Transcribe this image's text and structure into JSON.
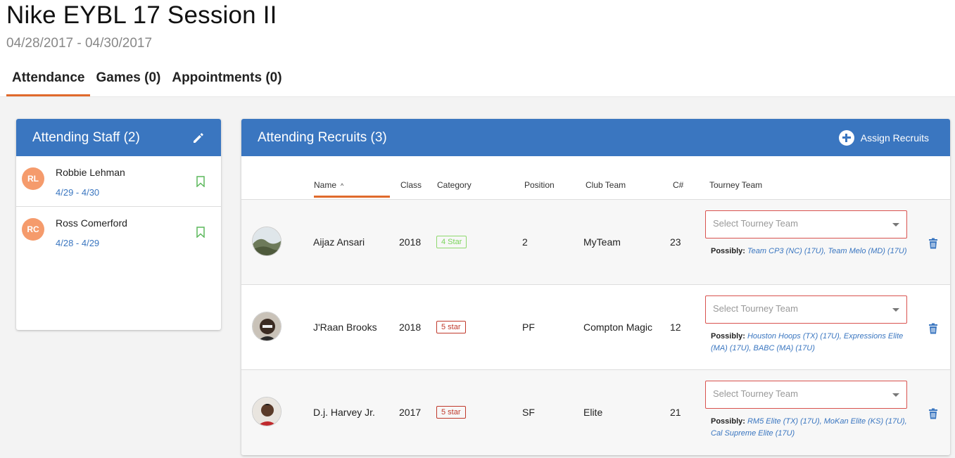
{
  "event": {
    "title": "Nike EYBL 17 Session II",
    "dates": "04/28/2017 - 04/30/2017"
  },
  "tabs": [
    {
      "label": "Attendance",
      "active": true
    },
    {
      "label": "Games (0)",
      "active": false
    },
    {
      "label": "Appointments (0)",
      "active": false
    }
  ],
  "staff": {
    "title": "Attending Staff (2)",
    "members": [
      {
        "initials": "RL",
        "name": "Robbie Lehman",
        "dates": "4/29 - 4/30"
      },
      {
        "initials": "RC",
        "name": "Ross Comerford",
        "dates": "4/28 - 4/29"
      }
    ]
  },
  "recruits": {
    "title": "Attending Recruits (3)",
    "assign_label": "Assign Recruits",
    "columns": {
      "name": "Name",
      "class": "Class",
      "category": "Category",
      "position": "Position",
      "club_team": "Club Team",
      "c_num": "C#",
      "tourney_team": "Tourney Team"
    },
    "rows": [
      {
        "name": "Aijaz Ansari",
        "class": "2018",
        "category": "4 Star",
        "category_color": "#7ad35a",
        "position": "2",
        "club_team": "MyTeam",
        "c_num": "23",
        "select_placeholder": "Select Tourney Team",
        "possibly_label": "Possibly:",
        "possibly_teams": "Team CP3 (NC) (17U), Team Melo (MD) (17U)"
      },
      {
        "name": "J'Raan Brooks",
        "class": "2018",
        "category": "5 star",
        "category_color": "#c0392b",
        "position": "PF",
        "club_team": "Compton Magic",
        "c_num": "12",
        "select_placeholder": "Select Tourney Team",
        "possibly_label": "Possibly:",
        "possibly_teams": "Houston Hoops (TX) (17U), Expressions Elite (MA) (17U), BABC (MA) (17U)"
      },
      {
        "name": "D.j. Harvey Jr.",
        "class": "2017",
        "category": "5 star",
        "category_color": "#c0392b",
        "position": "SF",
        "club_team": "Elite",
        "c_num": "21",
        "select_placeholder": "Select Tourney Team",
        "possibly_label": "Possibly:",
        "possibly_teams": "RM5 Elite (TX) (17U), MoKan Elite (KS) (17U), Cal Supreme Elite (17U)"
      }
    ]
  },
  "colors": {
    "accent_blue": "#3a76c0",
    "tab_underline": "#e06a2c",
    "avatar_orange": "#f59b6c",
    "select_border": "#d9534f"
  }
}
